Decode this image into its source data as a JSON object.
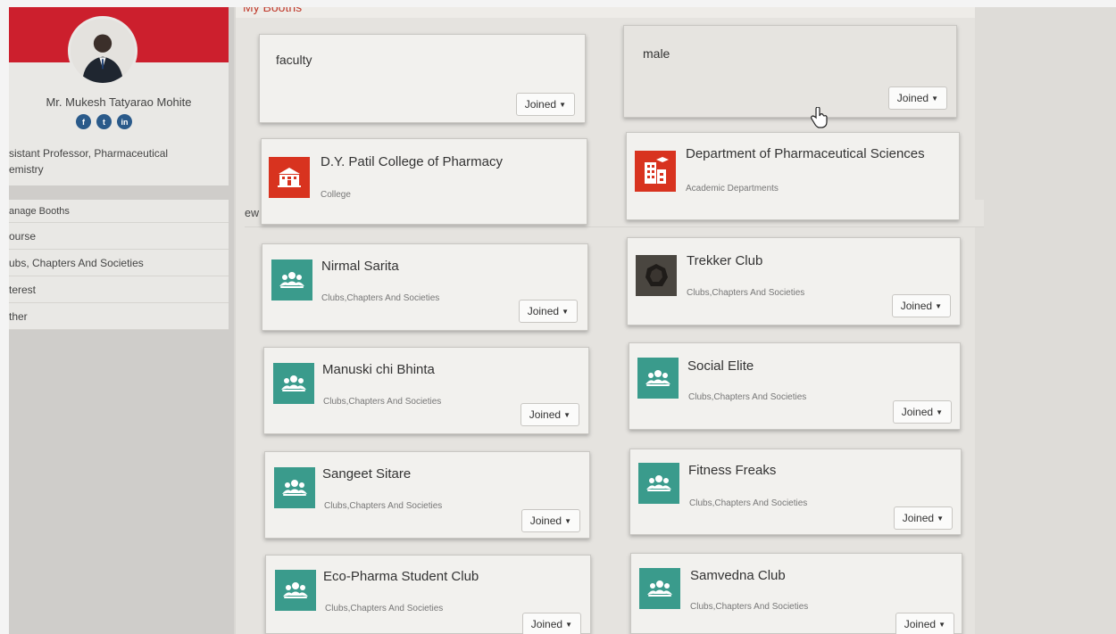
{
  "profile": {
    "name": "Mr. Mukesh Tatyarao Mohite",
    "role_line1": "sistant Professor, Pharmaceutical",
    "role_line2": "emistry",
    "socials": [
      {
        "icon": "facebook-icon",
        "glyph": "f"
      },
      {
        "icon": "twitter-icon",
        "glyph": "t"
      },
      {
        "icon": "linkedin-icon",
        "glyph": "in"
      }
    ]
  },
  "nav": {
    "view_booths": "ew My Booths",
    "manage_booths": "anage Booths",
    "items": [
      "ourse",
      "ubs, Chapters And Societies",
      "terest",
      "ther"
    ]
  },
  "main": {
    "title": "My Booths"
  },
  "cards": {
    "faculty": {
      "title": "faculty",
      "button": "Joined"
    },
    "male": {
      "title": "male",
      "button": "Joined"
    },
    "dypatil": {
      "title": "D.Y. Patil College of Pharmacy",
      "subtitle": "College",
      "icon": "college-building-icon"
    },
    "dept": {
      "title": "Department of Pharmaceutical Sciences",
      "subtitle": "Academic Departments",
      "icon": "department-building-icon"
    },
    "nirmal": {
      "title": "Nirmal Sarita",
      "subtitle": "Clubs,Chapters And Societies",
      "button": "Joined"
    },
    "trekker": {
      "title": "Trekker Club",
      "subtitle": "Clubs,Chapters And Societies",
      "button": "Joined"
    },
    "manuski": {
      "title": "Manuski chi Bhinta",
      "subtitle": "Clubs,Chapters And Societies",
      "button": "Joined"
    },
    "social": {
      "title": "Social Elite",
      "subtitle": "Clubs,Chapters And Societies",
      "button": "Joined"
    },
    "sangeet": {
      "title": "Sangeet Sitare",
      "subtitle": "Clubs,Chapters And Societies",
      "button": "Joined"
    },
    "fitness": {
      "title": "Fitness Freaks",
      "subtitle": "Clubs,Chapters And Societies",
      "button": "Joined"
    },
    "eco": {
      "title": "Eco-Pharma Student Club",
      "subtitle": "Clubs,Chapters And Societies",
      "button": "Joined"
    },
    "samvedna": {
      "title": "Samvedna Club",
      "subtitle": "Clubs,Chapters And Societies",
      "button": "Joined"
    }
  },
  "colors": {
    "brand_red": "#cc1f2d",
    "club_teal": "#3a9b8c",
    "college_red": "#d8331f"
  }
}
